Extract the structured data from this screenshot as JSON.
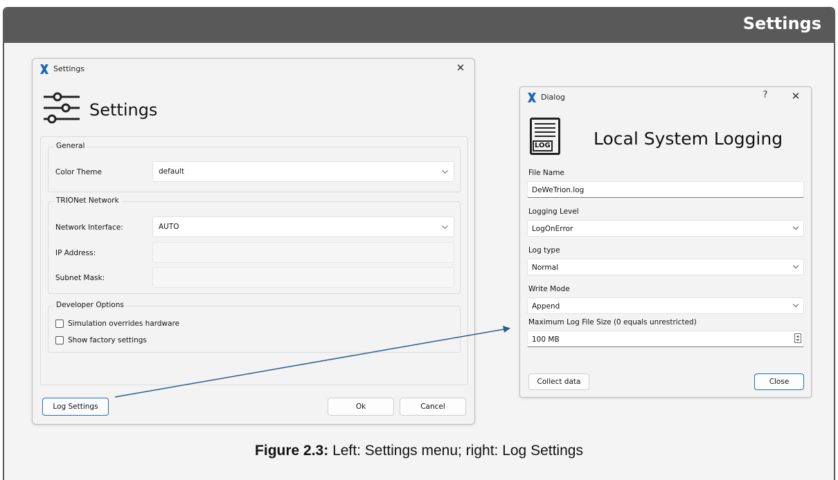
{
  "frame": {
    "title": "Settings"
  },
  "settings_window": {
    "title": "Settings",
    "header": "Settings",
    "close_glyph": "✕",
    "general": {
      "group_title": "General",
      "color_theme_label": "Color Theme",
      "color_theme_value": "default"
    },
    "trionet": {
      "group_title": "TRIONet Network",
      "network_interface_label": "Network Interface:",
      "network_interface_value": "AUTO",
      "ip_address_label": "IP Address:",
      "subnet_mask_label": "Subnet Mask:"
    },
    "developer": {
      "group_title": "Developer Options",
      "simulation_label": "Simulation overrides hardware",
      "factory_label": "Show factory settings"
    },
    "buttons": {
      "log_settings": "Log Settings",
      "ok": "Ok",
      "cancel": "Cancel"
    }
  },
  "dialog": {
    "title": "Dialog",
    "help_glyph": "?",
    "close_glyph": "✕",
    "header": "Local System Logging",
    "icon_text": "LOG",
    "file_name_label": "File Name",
    "file_name_value": "DeWeTrion.log",
    "logging_level_label": "Logging Level",
    "logging_level_value": "LogOnError",
    "log_type_label": "Log type",
    "log_type_value": "Normal",
    "write_mode_label": "Write Mode",
    "write_mode_value": "Append",
    "max_size_label": "Maximum Log File Size (0 equals unrestricted)",
    "max_size_value": "100 MB",
    "buttons": {
      "collect_data": "Collect data",
      "close": "Close"
    }
  },
  "caption": {
    "figure_label": "Figure 2.3:",
    "text": " Left: Settings menu; right: Log Settings"
  },
  "colors": {
    "accent": "#1d6fb5",
    "arrow": "#2b5c8a",
    "frame_header": "#595959"
  },
  "icons": [
    "app-x-icon",
    "close-icon",
    "sliders-icon",
    "help-icon",
    "log-file-icon",
    "chevron-down-icon",
    "spin-icon",
    "checkbox-icon"
  ]
}
